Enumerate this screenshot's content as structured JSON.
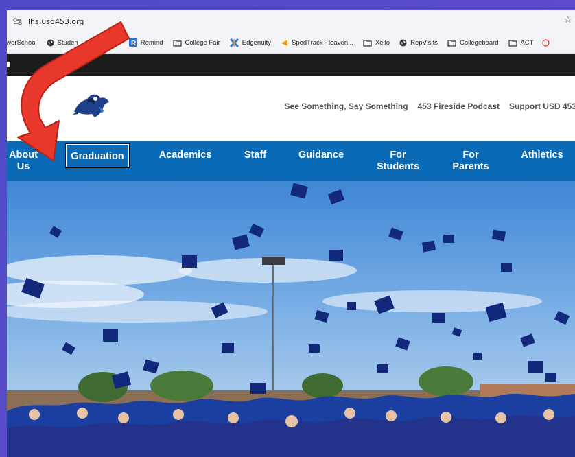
{
  "browser": {
    "url": "lhs.usd453.org",
    "bookmarks": [
      {
        "label": "owerSchool",
        "icon": "powerschool-icon"
      },
      {
        "label": "Studen",
        "icon": "globe-icon"
      },
      {
        "label": "Remind",
        "icon": "remind-icon",
        "color": "#2a6fd6"
      },
      {
        "label": "College Fair",
        "icon": "folder-icon"
      },
      {
        "label": "Edgenuity",
        "icon": "edgenuity-icon"
      },
      {
        "label": "SpedTrack - leaven...",
        "icon": "spedtrack-icon"
      },
      {
        "label": "Xello",
        "icon": "folder-icon"
      },
      {
        "label": "RepVisits",
        "icon": "globe-icon"
      },
      {
        "label": "Collegeboard",
        "icon": "folder-icon"
      },
      {
        "label": "ACT",
        "icon": "folder-icon"
      }
    ]
  },
  "header": {
    "links": [
      "See Something, Say Something",
      "453 Fireside Podcast",
      "Support USD 453"
    ]
  },
  "nav": {
    "items": [
      {
        "line1": "About",
        "line2": "Us"
      },
      {
        "line1": "Graduation",
        "line2": ""
      },
      {
        "line1": "Academics",
        "line2": ""
      },
      {
        "line1": "Staff",
        "line2": ""
      },
      {
        "line1": "Guidance",
        "line2": ""
      },
      {
        "line1": "For",
        "line2": "Students"
      },
      {
        "line1": "For",
        "line2": "Parents"
      },
      {
        "line1": "Athletics",
        "line2": ""
      }
    ]
  },
  "colors": {
    "nav_bg": "#0b6ab5",
    "arrow": "#e8382c",
    "frame": "#5a4fc4"
  },
  "hero": {
    "subject": "graduation-caps-photo"
  }
}
